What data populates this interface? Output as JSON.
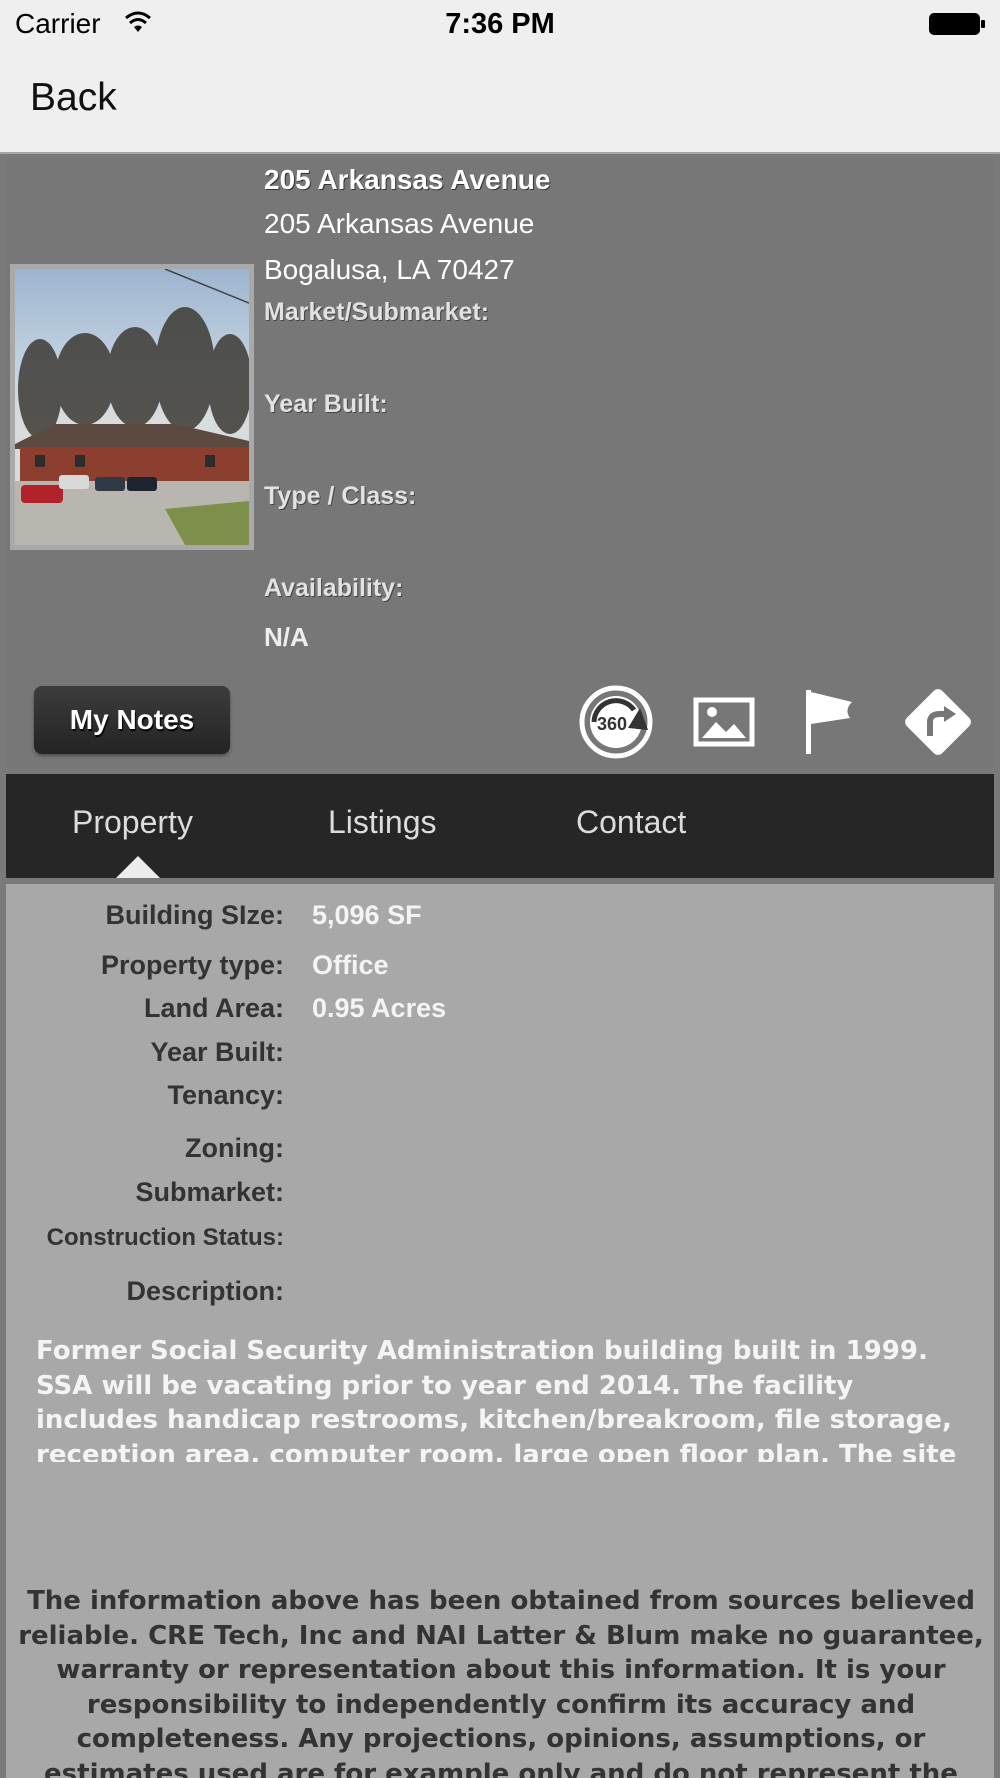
{
  "status_bar": {
    "carrier": "Carrier",
    "time": "7:36 PM"
  },
  "nav": {
    "back_label": "Back"
  },
  "property": {
    "name": "205 Arkansas Avenue",
    "address_line1": "205 Arkansas Avenue",
    "address_line2": "Bogalusa, LA 70427",
    "market_label": "Market/Submarket:",
    "market_value": "",
    "year_built_label": "Year Built:",
    "year_built_value": "",
    "type_class_label": "Type / Class:",
    "type_class_value": "",
    "availability_label": "Availability:",
    "availability_value": "N/A"
  },
  "actions": {
    "notes_label": "My Notes",
    "icons": [
      "360-view-icon",
      "gallery-icon",
      "flag-icon",
      "directions-icon"
    ],
    "view_360_text": "360"
  },
  "tabs": [
    {
      "label": "Property",
      "selected": true
    },
    {
      "label": "Listings",
      "selected": false
    },
    {
      "label": "Contact",
      "selected": false
    }
  ],
  "details": [
    {
      "label": "Building SIze:",
      "value": "5,096 SF"
    },
    {
      "label": "Property type:",
      "value": "Office"
    },
    {
      "label": "Land Area:",
      "value": "0.95 Acres"
    },
    {
      "label": "Year Built:",
      "value": ""
    },
    {
      "label": "Tenancy:",
      "value": ""
    },
    {
      "label": "Zoning:",
      "value": ""
    },
    {
      "label": "Submarket:",
      "value": ""
    },
    {
      "label": "Construction Status:",
      "value": ""
    },
    {
      "label": "Description:",
      "value": ""
    }
  ],
  "description": "Former Social Security Administration building built in 1999. SSA will be vacating prior to year end 2014.  The facility includes handicap restrooms, kitchen/breakroom, file storage, reception area, computer room, large open floor plan.  The site has  concrete parking surface with additional land to either add building square footage or parking spaces.",
  "disclaimer": "The information above has been obtained from sources believed reliable. CRE Tech, Inc and NAI Latter & Blum make no guarantee, warranty or representation about this information.  It is your responsibility to independently confirm its accuracy and completeness.  Any projections, opinions, assumptions, or estimates used are for example only and do not represent the current or future performance of the property.",
  "colors": {
    "header_bg": "#777777",
    "tab_bar_bg": "#262626",
    "details_bg": "#a8a8a8",
    "label_text": "#333333",
    "value_text": "#f4f4f4"
  }
}
